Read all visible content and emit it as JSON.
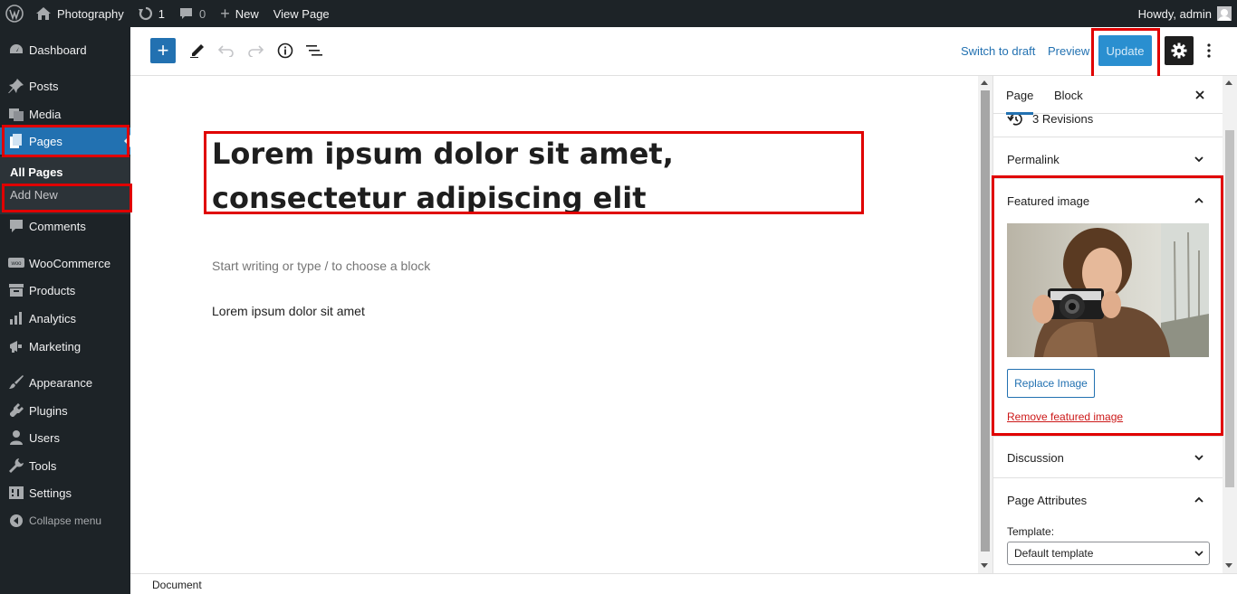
{
  "admin_bar": {
    "site_name": "Photography",
    "updates_count": "1",
    "comments_count": "0",
    "new_label": "New",
    "view_page_label": "View Page",
    "howdy": "Howdy, admin"
  },
  "sidebar": {
    "items": [
      {
        "label": "Dashboard",
        "icon": "dashboard-icon"
      },
      {
        "label": "Posts",
        "icon": "pin-icon"
      },
      {
        "label": "Media",
        "icon": "media-icon"
      },
      {
        "label": "Pages",
        "icon": "pages-icon",
        "current": true
      },
      {
        "label": "Comments",
        "icon": "comment-icon"
      },
      {
        "label": "WooCommerce",
        "icon": "woo-icon"
      },
      {
        "label": "Products",
        "icon": "archive-icon"
      },
      {
        "label": "Analytics",
        "icon": "bar-chart-icon"
      },
      {
        "label": "Marketing",
        "icon": "megaphone-icon"
      },
      {
        "label": "Appearance",
        "icon": "brush-icon"
      },
      {
        "label": "Plugins",
        "icon": "plugin-icon"
      },
      {
        "label": "Users",
        "icon": "user-icon"
      },
      {
        "label": "Tools",
        "icon": "wrench-icon"
      },
      {
        "label": "Settings",
        "icon": "settings-icon"
      }
    ],
    "submenu": [
      "All Pages",
      "Add New"
    ],
    "collapse_label": "Collapse menu"
  },
  "toolbar": {
    "switch_to_draft": "Switch to draft",
    "preview": "Preview",
    "update": "Update"
  },
  "editor": {
    "title": "Lorem ipsum dolor sit amet, consectetur adipiscing elit",
    "placeholder": "Start writing or type / to choose a block",
    "paragraph": "Lorem ipsum dolor sit amet"
  },
  "settings_sidebar": {
    "tabs": [
      "Page",
      "Block"
    ],
    "revisions": "3 Revisions",
    "permalink": "Permalink",
    "featured_image": "Featured image",
    "replace_image": "Replace Image",
    "remove_featured_image": "Remove featured image",
    "discussion": "Discussion",
    "page_attributes": "Page Attributes",
    "template_label": "Template:",
    "template_value": "Default template"
  },
  "footer": {
    "breadcrumb": "Document"
  },
  "colors": {
    "admin_dark": "#1d2327",
    "accent_blue": "#2271b1",
    "highlight_red": "#e00000",
    "remove_red": "#cc1818"
  }
}
